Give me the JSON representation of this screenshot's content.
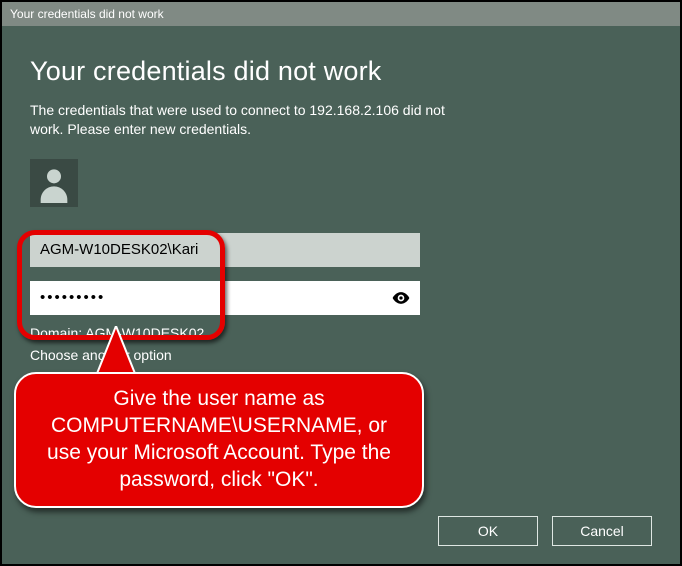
{
  "titlebar": {
    "text": "Your credentials did not work"
  },
  "heading": "Your credentials did not work",
  "message": "The credentials that were used to connect to 192.168.2.106 did not work. Please enter new credentials.",
  "form": {
    "username_value": "AGM-W10DESK02\\Kari",
    "password_value": "•••••••••",
    "domain_label": "Domain: AGM-W10DESK02",
    "choose_other": "Choose another option"
  },
  "buttons": {
    "ok": "OK",
    "cancel": "Cancel"
  },
  "annotation": {
    "text": "Give the user name as COMPUTERNAME\\USERNAME, or use your Microsoft Account. Type the password, click \"OK\"."
  }
}
